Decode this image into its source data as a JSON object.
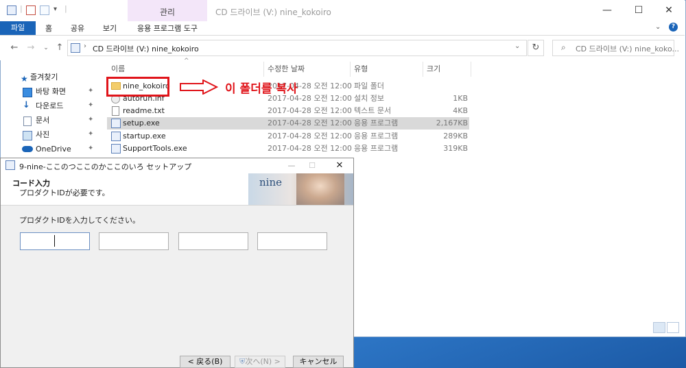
{
  "explorer": {
    "title": "CD 드라이브 (V:) nine_kokoiro",
    "manage_label": "관리",
    "ribbon_tabs": [
      "파일",
      "홈",
      "공유",
      "보기"
    ],
    "app_tools_label": "응용 프로그램 도구",
    "address": "CD 드라이브 (V:) nine_kokoiro",
    "search_placeholder": "CD 드라이브 (V:) nine_koko...",
    "window_controls": {
      "minimize": "—",
      "maximize": "☐",
      "close": "✕"
    },
    "sidebar": [
      {
        "label": "즐겨찾기",
        "icon": "star-icon"
      },
      {
        "label": "바탕 화면",
        "icon": "desktop-icon"
      },
      {
        "label": "다운로드",
        "icon": "download-icon"
      },
      {
        "label": "문서",
        "icon": "document-icon"
      },
      {
        "label": "사진",
        "icon": "picture-icon"
      },
      {
        "label": "OneDrive",
        "icon": "cloud-icon"
      }
    ],
    "columns": {
      "name": "이름",
      "date": "수정한 날짜",
      "type": "유형",
      "size": "크기"
    },
    "files": [
      {
        "name": "nine_kokoiro",
        "date": "2017-04-28 오전 12:00",
        "type": "파일 폴더",
        "size": "",
        "icon": "folder-icon"
      },
      {
        "name": "autorun.inf",
        "date": "2017-04-28 오전 12:00",
        "type": "설치 정보",
        "size": "1KB",
        "icon": "settings-file-icon"
      },
      {
        "name": "readme.txt",
        "date": "2017-04-28 오전 12:00",
        "type": "텍스트 문서",
        "size": "4KB",
        "icon": "text-file-icon"
      },
      {
        "name": "setup.exe",
        "date": "2017-04-28 오전 12:00",
        "type": "응용 프로그램",
        "size": "2,167KB",
        "icon": "app-icon"
      },
      {
        "name": "startup.exe",
        "date": "2017-04-28 오전 12:00",
        "type": "응용 프로그램",
        "size": "289KB",
        "icon": "app-icon"
      },
      {
        "name": "SupportTools.exe",
        "date": "2017-04-28 오전 12:00",
        "type": "응용 프로그램",
        "size": "319KB",
        "icon": "app-icon"
      }
    ]
  },
  "annotation": {
    "text": "이 폴더를 복사",
    "color": "#e0141a"
  },
  "dialog": {
    "title": "9-nine-ここのつここのかここのいろ セットアップ",
    "heading": "コード入力",
    "subheading": "プロダクトIDが必要です。",
    "prompt": "プロダクトIDを入力してください。",
    "banner_text": "nine",
    "fields": [
      "",
      "",
      "",
      ""
    ],
    "buttons": {
      "back": "< 戻る(B)",
      "next": "次へ(N) >",
      "cancel": "キャンセル"
    }
  }
}
